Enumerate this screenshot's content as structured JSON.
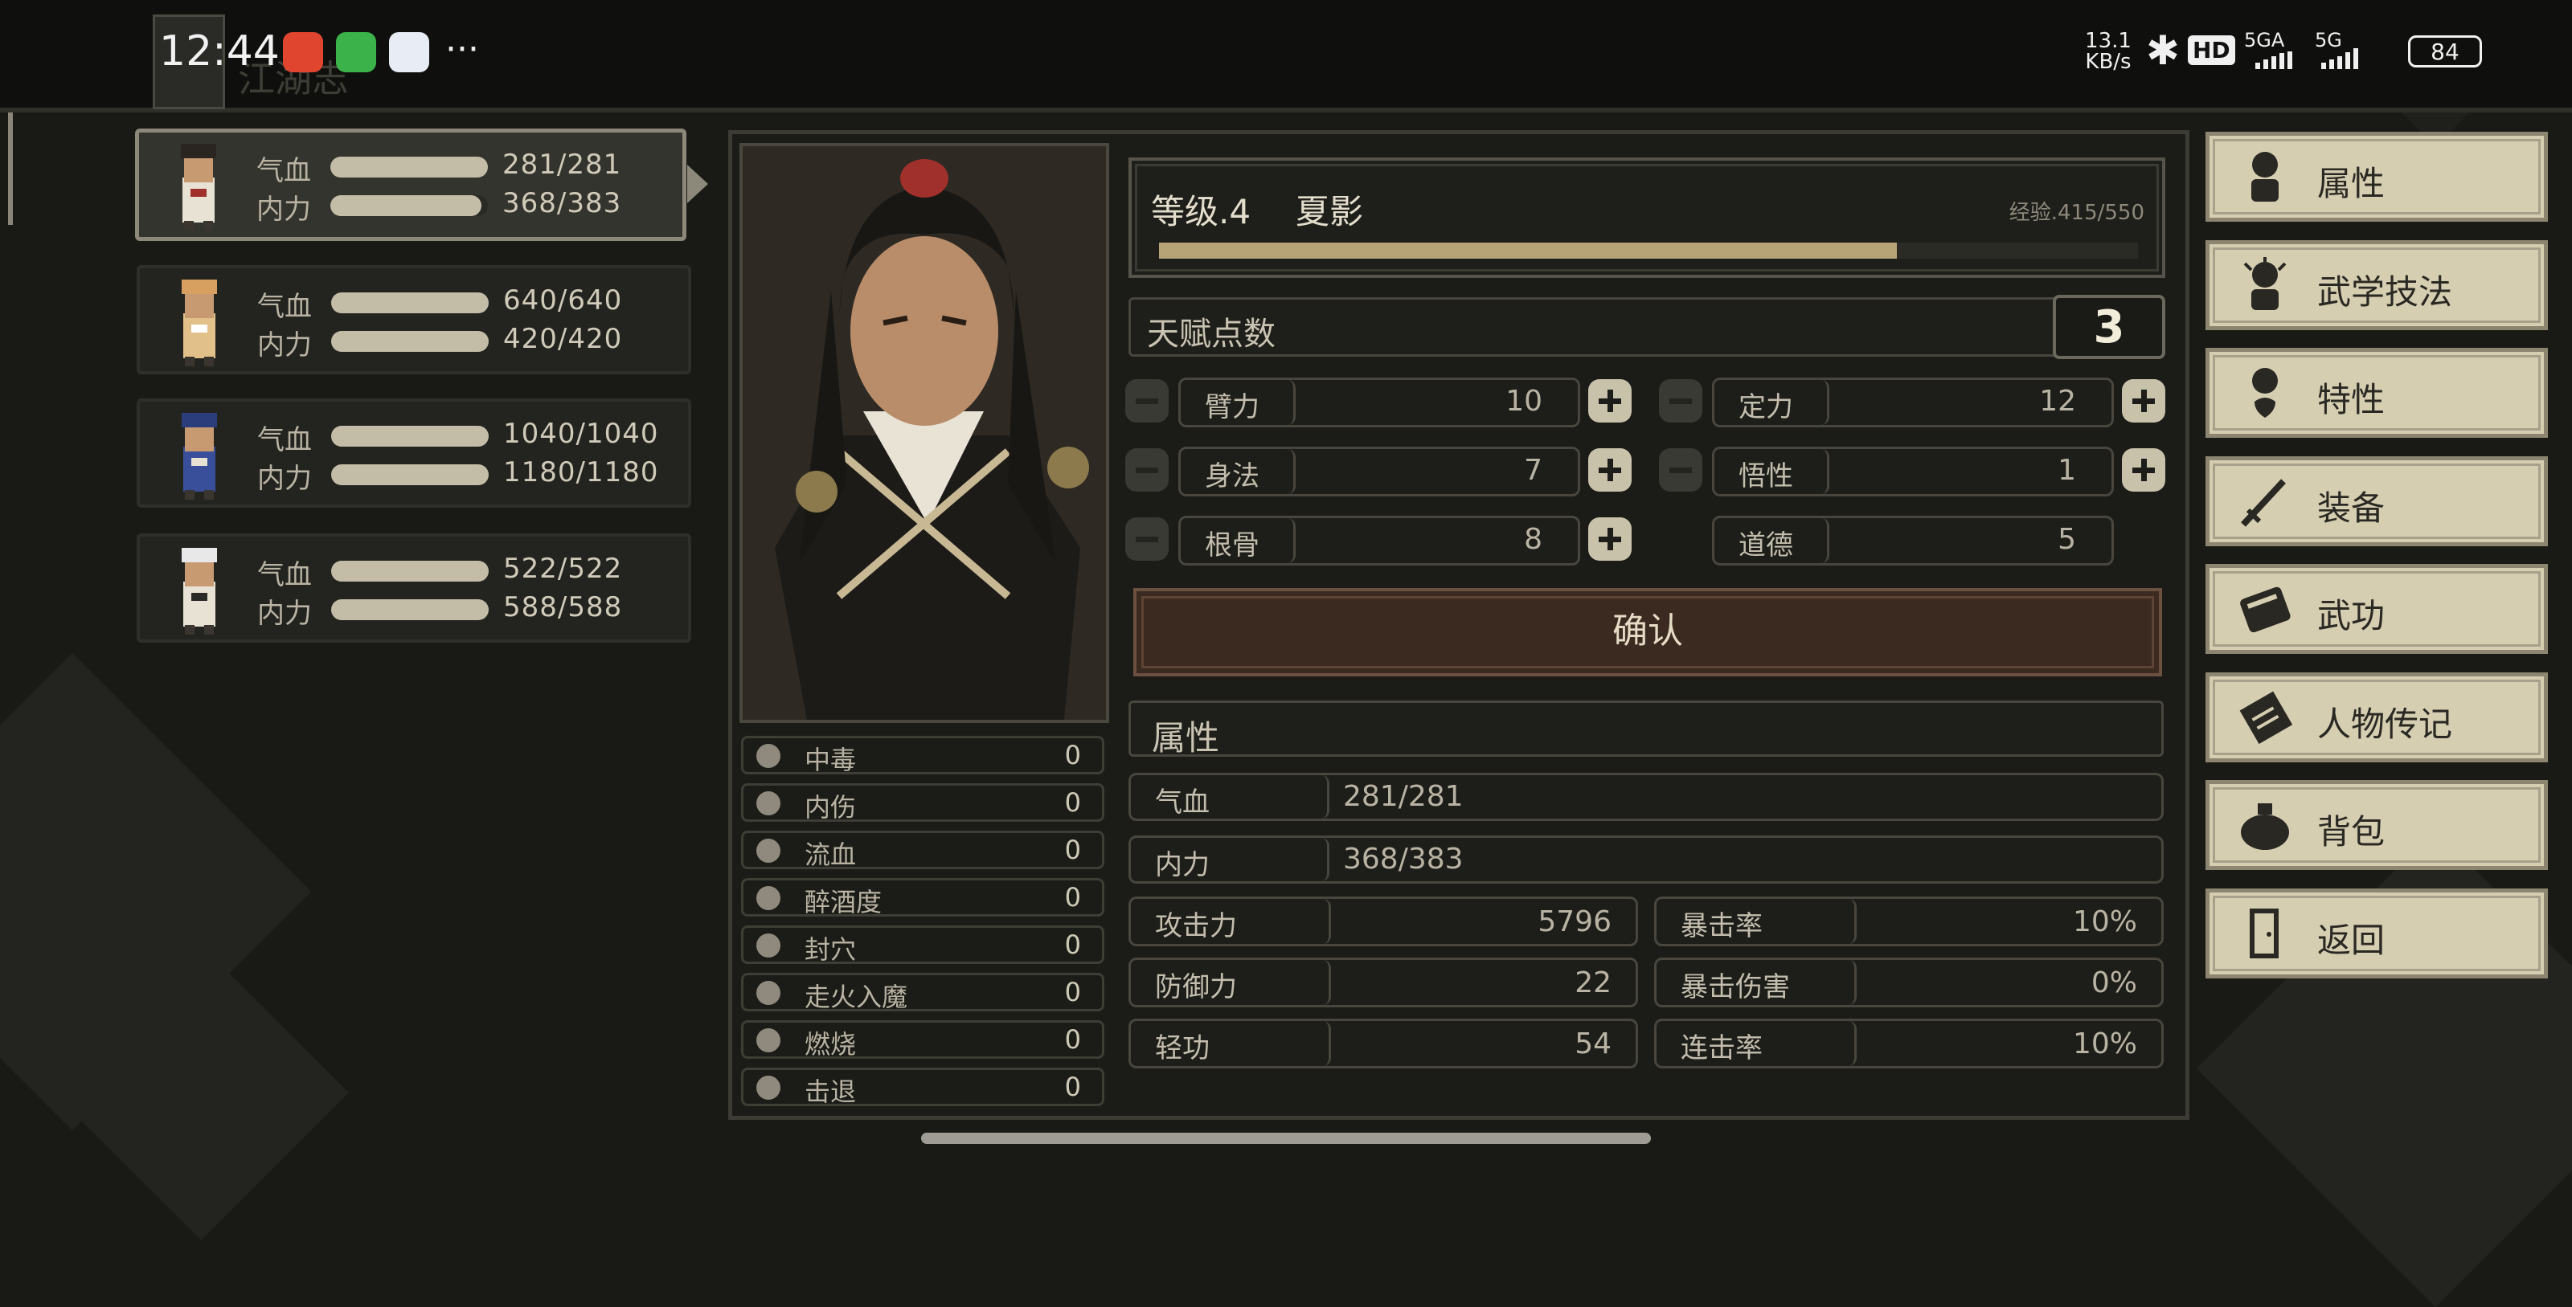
{
  "status_bar": {
    "time": "12:44",
    "net_speed_value": "13.1",
    "net_speed_unit": "KB/s",
    "hd_label": "HD",
    "sim1_label": "5GA",
    "sim2_label": "5G",
    "battery": "84",
    "more_label": "···"
  },
  "party": [
    {
      "hp_label": "气血",
      "hp": "281/281",
      "mp_label": "内力",
      "mp": "368/383",
      "hp_frac": 1.0,
      "mp_frac": 0.96
    },
    {
      "hp_label": "气血",
      "hp": "640/640",
      "mp_label": "内力",
      "mp": "420/420",
      "hp_frac": 1.0,
      "mp_frac": 1.0
    },
    {
      "hp_label": "气血",
      "hp": "1040/1040",
      "mp_label": "内力",
      "mp": "1180/1180",
      "hp_frac": 1.0,
      "mp_frac": 1.0
    },
    {
      "hp_label": "气血",
      "hp": "522/522",
      "mp_label": "内力",
      "mp": "588/588",
      "hp_frac": 1.0,
      "mp_frac": 1.0
    }
  ],
  "character": {
    "level_text": "等级.4",
    "name": "夏影",
    "exp_text": "经验.415/550",
    "exp_frac": 0.754,
    "talent_label": "天赋点数",
    "talent_points": "3"
  },
  "stats": {
    "arm_label": "臂力",
    "arm": "10",
    "focus_label": "定力",
    "focus": "12",
    "agility_label": "身法",
    "agility": "7",
    "insight_label": "悟性",
    "insight": "1",
    "bone_label": "根骨",
    "bone": "8",
    "morality_label": "道德",
    "morality": "5"
  },
  "confirm_label": "确认",
  "attributes": {
    "section_title": "属性",
    "hp_label": "气血",
    "hp": "281/281",
    "mp_label": "内力",
    "mp": "368/383",
    "atk_label": "攻击力",
    "atk": "5796",
    "crit_label": "暴击率",
    "crit": "10%",
    "def_label": "防御力",
    "def": "22",
    "critdmg_label": "暴击伤害",
    "critdmg": "0%",
    "qinggong_label": "轻功",
    "qinggong": "54",
    "combo_label": "连击率",
    "combo": "10%"
  },
  "effects": [
    {
      "label": "中毒",
      "value": "0",
      "icon": "skull-icon"
    },
    {
      "label": "内伤",
      "value": "0",
      "icon": "broken-heart-icon"
    },
    {
      "label": "流血",
      "value": "0",
      "icon": "blood-icon"
    },
    {
      "label": "醉酒度",
      "value": "0",
      "icon": "drunk-icon"
    },
    {
      "label": "封穴",
      "value": "0",
      "icon": "acupoint-icon"
    },
    {
      "label": "走火入魔",
      "value": "0",
      "icon": "demon-icon"
    },
    {
      "label": "燃烧",
      "value": "0",
      "icon": "fire-icon"
    },
    {
      "label": "击退",
      "value": "0",
      "icon": "boot-icon"
    }
  ],
  "menu": [
    {
      "label": "属性",
      "icon": "figure-icon"
    },
    {
      "label": "武学技法",
      "icon": "figure-sparkle-icon"
    },
    {
      "label": "特性",
      "icon": "figure-heart-icon"
    },
    {
      "label": "装备",
      "icon": "sword-icon"
    },
    {
      "label": "武功",
      "icon": "book-icon"
    },
    {
      "label": "人物传记",
      "icon": "scroll-icon"
    },
    {
      "label": "背包",
      "icon": "bag-icon"
    },
    {
      "label": "返回",
      "icon": "door-icon"
    }
  ],
  "colors": {
    "menu_bg": "#d6ceb1",
    "exp_fill": "#b6a477",
    "confirm_bg": "#3b2a20"
  }
}
